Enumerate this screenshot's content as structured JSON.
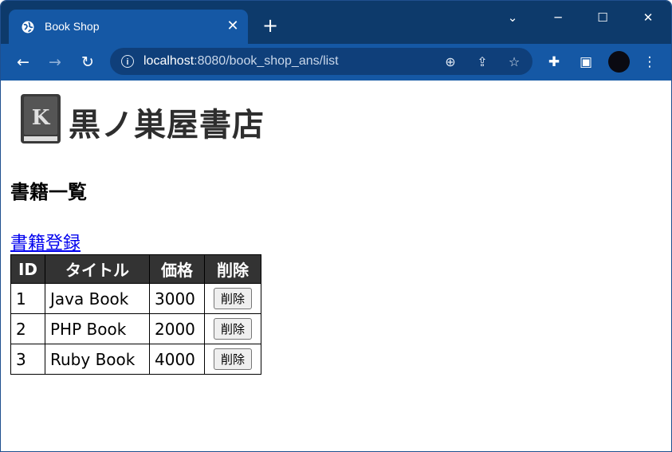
{
  "browser": {
    "tab_title": "Book Shop",
    "tab_close": "✕",
    "new_tab": "+",
    "url_host": "localhost",
    "url_rest": ":8080/book_shop_ans/list",
    "window_controls": {
      "chevron": "⌄",
      "minimize": "─",
      "maximize": "☐",
      "close": "✕"
    },
    "nav": {
      "back": "←",
      "forward": "→",
      "reload": "↻"
    },
    "info": "i",
    "omni_icons": {
      "zoom": "⊕",
      "share": "⇪",
      "star": "☆"
    },
    "toolbar_icons": {
      "extensions": "✚",
      "sidepanel": "▣",
      "menu": "⋮"
    }
  },
  "page": {
    "logo_letter": "K",
    "logo_text": "黒ノ巣屋書店",
    "title": "書籍一覧",
    "register_link": "書籍登録"
  },
  "table": {
    "headers": [
      "ID",
      "タイトル",
      "価格",
      "削除"
    ],
    "rows": [
      {
        "id": "1",
        "title": "Java Book",
        "price": "3000",
        "action": "削除"
      },
      {
        "id": "2",
        "title": "PHP Book",
        "price": "2000",
        "action": "削除"
      },
      {
        "id": "3",
        "title": "Ruby Book",
        "price": "4000",
        "action": "削除"
      }
    ]
  },
  "colors": {
    "titlebar": "#0d3a6b",
    "toolbar": "#1558a5",
    "header_bg": "#333333",
    "link": "#0000ee"
  }
}
